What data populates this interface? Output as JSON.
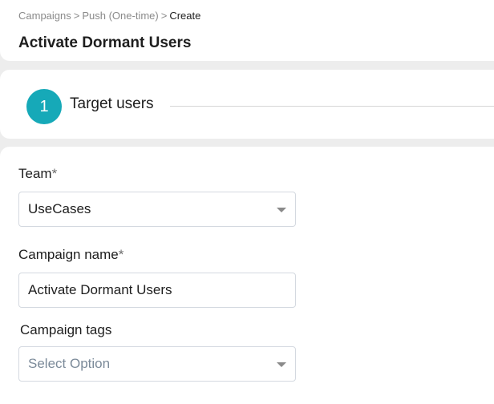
{
  "breadcrumb": {
    "items": [
      "Campaigns",
      "Push (One-time)",
      "Create"
    ],
    "separator": ">"
  },
  "page_title": "Activate Dormant Users",
  "stepper": {
    "step_number": "1",
    "step_label": "Target users",
    "accent_color": "#16a9b8"
  },
  "form": {
    "team": {
      "label": "Team",
      "required_mark": "*",
      "value": "UseCases"
    },
    "campaign_name": {
      "label": "Campaign name",
      "required_mark": "*",
      "value": "Activate Dormant Users"
    },
    "campaign_tags": {
      "label": "Campaign tags",
      "placeholder": "Select Option"
    }
  }
}
